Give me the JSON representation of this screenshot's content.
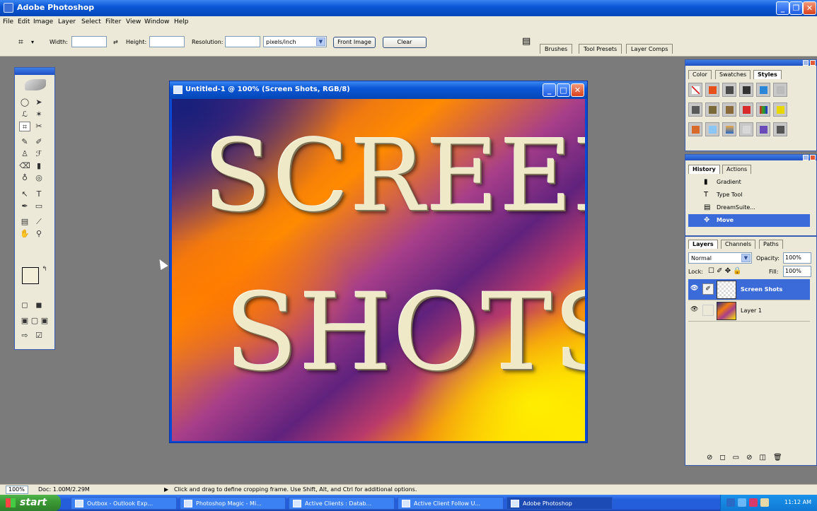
{
  "app": {
    "title": "Adobe Photoshop"
  },
  "menu": [
    "File",
    "Edit",
    "Image",
    "Layer",
    "Select",
    "Filter",
    "View",
    "Window",
    "Help"
  ],
  "options": {
    "width_label": "Width:",
    "width_value": "",
    "height_label": "Height:",
    "height_value": "",
    "resolution_label": "Resolution:",
    "resolution_value": "",
    "resolution_unit": "pixels/inch",
    "front_image_label": "Front Image",
    "clear_label": "Clear",
    "well_tabs": [
      "Brushes",
      "Tool Presets",
      "Layer Comps"
    ]
  },
  "document": {
    "title": "Untitled-1 @ 100% (Screen Shots, RGB/8)",
    "text_line1": "SCREEN",
    "text_line2": "SHOTS"
  },
  "styles_panel": {
    "tabs": [
      "Color",
      "Swatches",
      "Styles"
    ],
    "active_tab": "Styles"
  },
  "history_panel": {
    "tabs": [
      "History",
      "Actions"
    ],
    "items": [
      {
        "label": "Gradient",
        "icon": "gradient-icon"
      },
      {
        "label": "Type Tool",
        "icon": "type-icon"
      },
      {
        "label": "DreamSuite...",
        "icon": "filter-icon"
      },
      {
        "label": "Move",
        "icon": "move-icon",
        "selected": true
      }
    ]
  },
  "layers_panel": {
    "tabs": [
      "Layers",
      "Channels",
      "Paths"
    ],
    "blend_mode": "Normal",
    "opacity_label": "Opacity:",
    "opacity_value": "100%",
    "lock_label": "Lock:",
    "fill_label": "Fill:",
    "fill_value": "100%",
    "layers": [
      {
        "name": "Screen Shots",
        "selected": true
      },
      {
        "name": "Layer 1",
        "selected": false
      }
    ]
  },
  "status": {
    "zoom": "100%",
    "doc": "Doc: 1.00M/2.29M",
    "hint": "Click and drag to define cropping frame. Use Shift, Alt, and Ctrl for additional options."
  },
  "taskbar": {
    "start": "start",
    "tasks": [
      "Outbox - Outlook Exp...",
      "Photoshop Magic - Mi...",
      "Active Clients : Datab...",
      "Active Client Follow U...",
      "Adobe Photoshop"
    ],
    "clock": "11:12 AM"
  }
}
